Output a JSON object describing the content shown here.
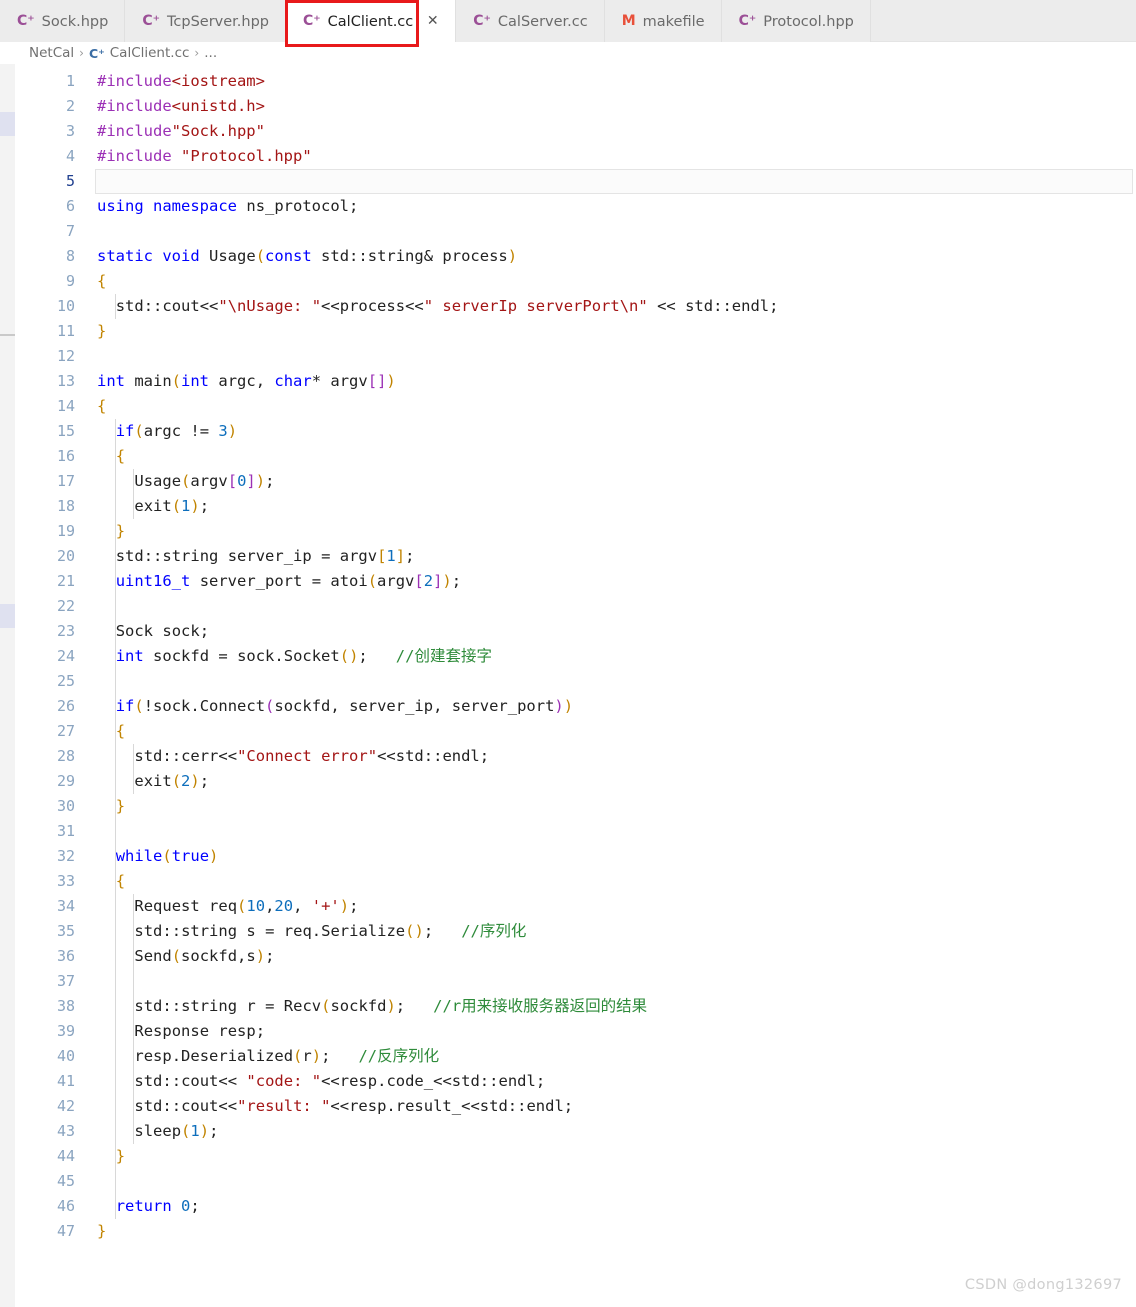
{
  "tabs": [
    {
      "label": "Sock.hpp",
      "icon": "cpp-file-icon",
      "icon_glyph": "C",
      "active": false,
      "closable": false
    },
    {
      "label": "TcpServer.hpp",
      "icon": "cpp-file-icon",
      "icon_glyph": "C",
      "active": false,
      "closable": false
    },
    {
      "label": "CalClient.cc",
      "icon": "cpp-file-icon",
      "icon_glyph": "C",
      "active": true,
      "closable": true,
      "close_glyph": "✕"
    },
    {
      "label": "CalServer.cc",
      "icon": "cpp-file-icon",
      "icon_glyph": "C",
      "active": false,
      "closable": false
    },
    {
      "label": "makefile",
      "icon": "makefile-file-icon",
      "icon_glyph": "M",
      "active": false,
      "closable": false
    },
    {
      "label": "Protocol.hpp",
      "icon": "cpp-file-icon",
      "icon_glyph": "C",
      "active": false,
      "closable": false
    }
  ],
  "breadcrumb": {
    "items": [
      "NetCal",
      "CalClient.cc",
      "..."
    ],
    "separator": "›",
    "file_icon": "cpp-file-icon",
    "file_icon_glyph": "C"
  },
  "colors": {
    "keyword": "#0000ff",
    "preprocessor": "#9b30b5",
    "string": "#a31515",
    "comment": "#2e8b3a",
    "number": "#0d6ebc",
    "plain": "#222222",
    "annotation_box": "#e8191b",
    "tabbar_bg": "#ececec",
    "active_tab_bg": "#ffffff",
    "line_number": "#8aa4c0",
    "active_line_number": "#1f3f8f"
  },
  "editor": {
    "current_line": 5,
    "total_lines": 47,
    "language": "C++",
    "lines": [
      {
        "n": 1,
        "text": "#include<iostream>"
      },
      {
        "n": 2,
        "text": "#include<unistd.h>"
      },
      {
        "n": 3,
        "text": "#include\"Sock.hpp\""
      },
      {
        "n": 4,
        "text": "#include \"Protocol.hpp\""
      },
      {
        "n": 5,
        "text": ""
      },
      {
        "n": 6,
        "text": "using namespace ns_protocol;"
      },
      {
        "n": 7,
        "text": ""
      },
      {
        "n": 8,
        "text": "static void Usage(const std::string& process)"
      },
      {
        "n": 9,
        "text": "{"
      },
      {
        "n": 10,
        "text": "  std::cout<<\"\\nUsage: \"<<process<<\" serverIp serverPort\\n\" << std::endl;"
      },
      {
        "n": 11,
        "text": "}"
      },
      {
        "n": 12,
        "text": ""
      },
      {
        "n": 13,
        "text": "int main(int argc, char* argv[])"
      },
      {
        "n": 14,
        "text": "{"
      },
      {
        "n": 15,
        "text": "  if(argc != 3)"
      },
      {
        "n": 16,
        "text": "  {"
      },
      {
        "n": 17,
        "text": "    Usage(argv[0]);"
      },
      {
        "n": 18,
        "text": "    exit(1);"
      },
      {
        "n": 19,
        "text": "  }"
      },
      {
        "n": 20,
        "text": "  std::string server_ip = argv[1];"
      },
      {
        "n": 21,
        "text": "  uint16_t server_port = atoi(argv[2]);"
      },
      {
        "n": 22,
        "text": ""
      },
      {
        "n": 23,
        "text": "  Sock sock;"
      },
      {
        "n": 24,
        "text": "  int sockfd = sock.Socket();   //创建套接字"
      },
      {
        "n": 25,
        "text": ""
      },
      {
        "n": 26,
        "text": "  if(!sock.Connect(sockfd, server_ip, server_port))"
      },
      {
        "n": 27,
        "text": "  {"
      },
      {
        "n": 28,
        "text": "    std::cerr<<\"Connect error\"<<std::endl;"
      },
      {
        "n": 29,
        "text": "    exit(2);"
      },
      {
        "n": 30,
        "text": "  }"
      },
      {
        "n": 31,
        "text": ""
      },
      {
        "n": 32,
        "text": "  while(true)"
      },
      {
        "n": 33,
        "text": "  {"
      },
      {
        "n": 34,
        "text": "    Request req(10,20, '+');"
      },
      {
        "n": 35,
        "text": "    std::string s = req.Serialize();   //序列化"
      },
      {
        "n": 36,
        "text": "    Send(sockfd,s);"
      },
      {
        "n": 37,
        "text": ""
      },
      {
        "n": 38,
        "text": "    std::string r = Recv(sockfd);   //r用来接收服务器返回的结果"
      },
      {
        "n": 39,
        "text": "    Response resp;"
      },
      {
        "n": 40,
        "text": "    resp.Deserialized(r);   //反序列化"
      },
      {
        "n": 41,
        "text": "    std::cout<< \"code: \"<<resp.code_<<std::endl;"
      },
      {
        "n": 42,
        "text": "    std::cout<<\"result: \"<<resp.result_<<std::endl;"
      },
      {
        "n": 43,
        "text": "    sleep(1);"
      },
      {
        "n": 44,
        "text": "  }"
      },
      {
        "n": 45,
        "text": ""
      },
      {
        "n": 46,
        "text": "  return 0;"
      },
      {
        "n": 47,
        "text": "}"
      }
    ]
  },
  "watermark": {
    "text": "CSDN @dong132697"
  }
}
